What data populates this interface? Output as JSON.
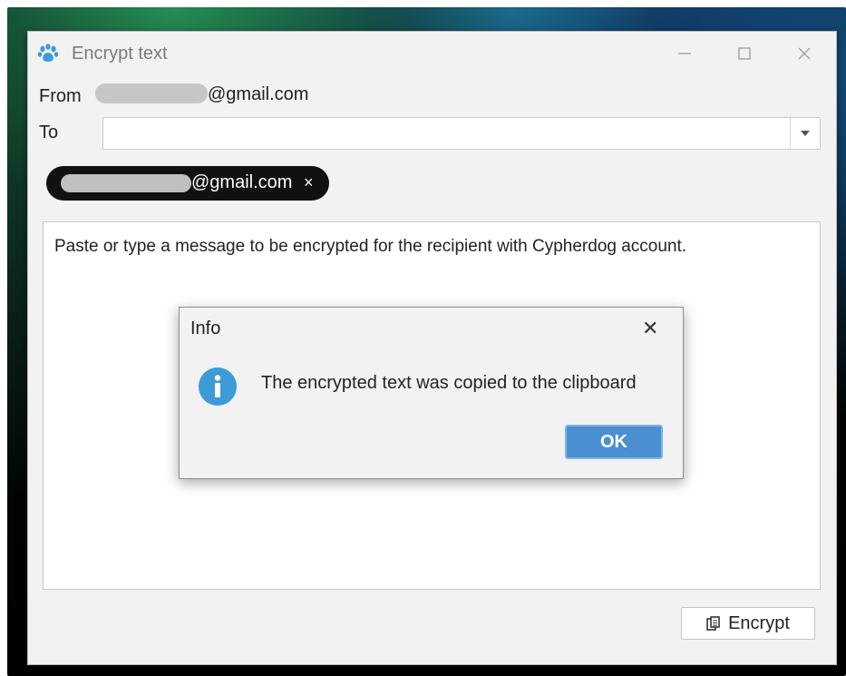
{
  "window": {
    "title": "Encrypt text",
    "app_icon": "paw-icon",
    "controls": [
      "minimize-icon",
      "maximize-icon",
      "close-icon"
    ]
  },
  "form": {
    "from_label": "From",
    "from_email_suffix": "@gmail.com",
    "to_label": "To",
    "to_value": ""
  },
  "recipients": [
    {
      "email_suffix": "@gmail.com",
      "remove_label": "×"
    }
  ],
  "message": {
    "placeholder": "Paste or type a message to be encrypted for the recipient with Cypherdog account."
  },
  "actions": {
    "encrypt_label": "Encrypt",
    "encrypt_icon": "copy-icon"
  },
  "dialog": {
    "title": "Info",
    "close_label": "✕",
    "icon": "info-icon",
    "message": "The encrypted text was copied to the clipboard",
    "ok_label": "OK"
  },
  "colors": {
    "accent": "#3d9bd8",
    "ok_button": "#4a8fd0",
    "chip_bg": "#111111"
  }
}
